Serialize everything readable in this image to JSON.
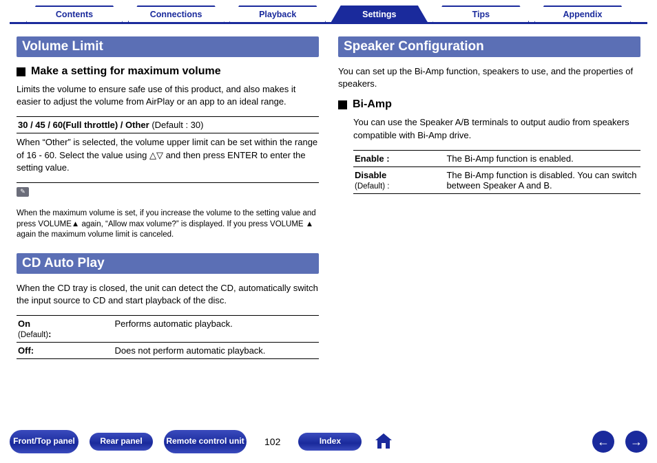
{
  "tabs": {
    "items": [
      "Contents",
      "Connections",
      "Playback",
      "Settings",
      "Tips",
      "Appendix"
    ],
    "active": 3
  },
  "left": {
    "section1": {
      "title": "Volume Limit",
      "sub": "Make a setting for maximum volume",
      "intro": "Limits the volume to ensure safe use of this product, and also makes it easier to adjust the volume from AirPlay or an app to an ideal range.",
      "opt_bold": "30 / 45 / 60(Full throttle) / Other",
      "opt_def": " (Default : 30)",
      "opt_desc": "When “Other” is selected, the volume upper limit can be set within the range of 16 - 60. Select the value using △▽ and then press ENTER to enter the setting value.",
      "note": "When the maximum volume is set, if you increase the volume to the setting value and press VOLUME▲ again, “Allow max volume?” is displayed. If you press VOLUME ▲ again the maximum volume limit is canceled."
    },
    "section2": {
      "title": "CD Auto Play",
      "intro": "When the CD tray is closed, the unit can detect the CD, automatically switch the input source to CD and start playback of the disc.",
      "rows": [
        {
          "k": "On",
          "kdef": "(Default)",
          "v": "Performs automatic playback."
        },
        {
          "k": "Off:",
          "kdef": "",
          "v": "Does not perform automatic playback."
        }
      ]
    }
  },
  "right": {
    "section1": {
      "title": "Speaker Configuration",
      "intro": "You can set up the Bi-Amp function, speakers to use, and the properties of speakers.",
      "sub": "Bi-Amp",
      "sub_intro": "You can use the Speaker A/B terminals to output audio from speakers compatible with Bi-Amp drive.",
      "rows": [
        {
          "k": "Enable :",
          "kdef": "",
          "v": "The Bi-Amp function is enabled."
        },
        {
          "k": "Disable",
          "kdef": "(Default) :",
          "v": "The Bi-Amp function is disabled. You can switch between Speaker A and B."
        }
      ]
    }
  },
  "footer": {
    "buttons": [
      "Front/Top panel",
      "Rear panel",
      "Remote control unit"
    ],
    "page": "102",
    "index": "Index"
  }
}
